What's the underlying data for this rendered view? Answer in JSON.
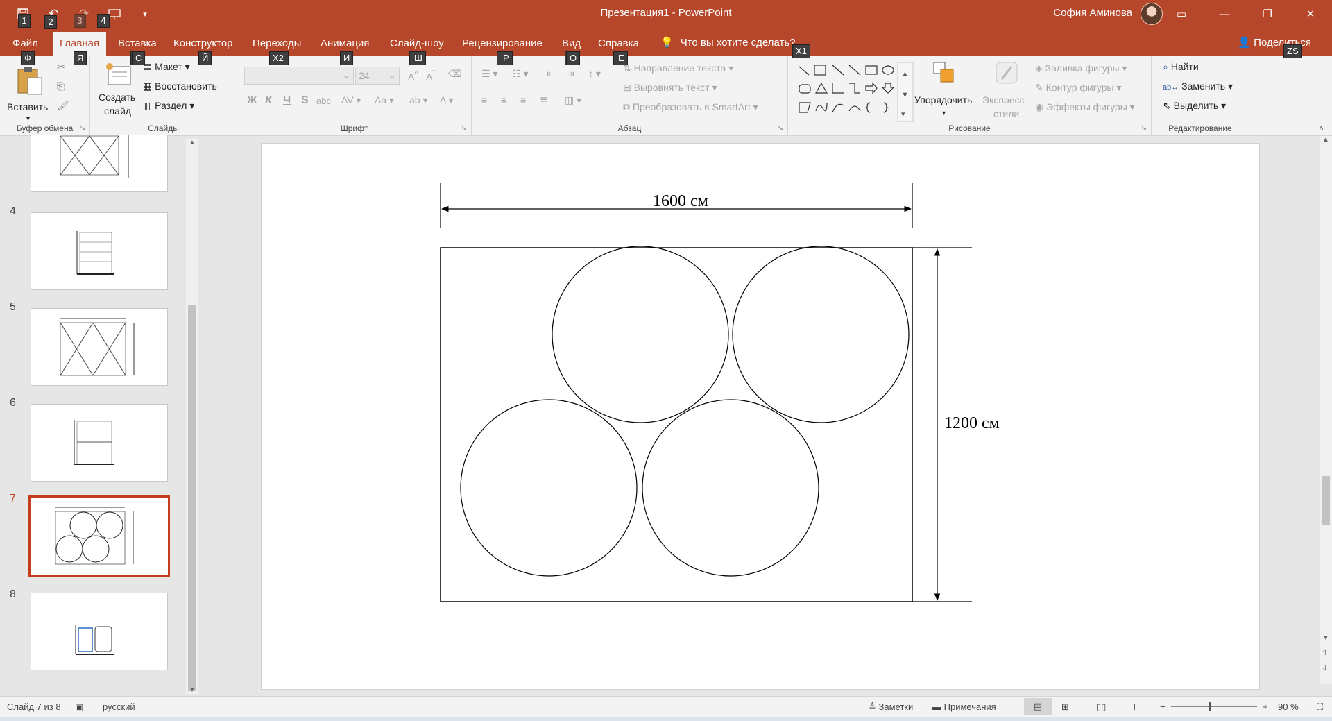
{
  "window": {
    "title": "Презентация1  -  PowerPoint",
    "user": "София Аминова"
  },
  "qat_keytips": [
    "1",
    "2",
    "3",
    "4"
  ],
  "tabs": [
    {
      "label": "Файл",
      "keytip": "Ф"
    },
    {
      "label": "Главная",
      "keytip": "Я"
    },
    {
      "label": "Вставка",
      "keytip": "С"
    },
    {
      "label": "Конструктор",
      "keytip": "Й"
    },
    {
      "label": "Переходы",
      "keytip": "Х2"
    },
    {
      "label": "Анимация",
      "keytip": "И"
    },
    {
      "label": "Слайд-шоу",
      "keytip": "Ш"
    },
    {
      "label": "Рецензирование",
      "keytip": "Р"
    },
    {
      "label": "Вид",
      "keytip": "О"
    },
    {
      "label": "Справка",
      "keytip": "Е"
    }
  ],
  "tell_me": "Что вы хотите сделать?",
  "tell_me_keytip": "Х1",
  "share": "Поделиться",
  "share_keytip": "ZS",
  "ribbon": {
    "clipboard": {
      "paste": "Вставить",
      "label": "Буфер обмена"
    },
    "slides": {
      "new_slide_1": "Создать",
      "new_slide_2": "слайд",
      "layout": "Макет",
      "reset": "Восстановить",
      "section": "Раздел",
      "label": "Слайды"
    },
    "font": {
      "size": "24",
      "bold": "Ж",
      "italic": "К",
      "underline": "Ч",
      "shadow": "S",
      "strike": "abc",
      "spacing": "AV",
      "case": "Aa",
      "label": "Шрифт"
    },
    "paragraph": {
      "text_direction": "Направление текста",
      "align_text": "Выровнять текст",
      "smartart": "Преобразовать в SmartArt",
      "label": "Абзац"
    },
    "drawing": {
      "arrange": "Упорядочить",
      "quick_styles_1": "Экспресс-",
      "quick_styles_2": "стили",
      "fill": "Заливка фигуры",
      "outline": "Контур фигуры",
      "effects": "Эффекты фигуры",
      "label": "Рисование"
    },
    "editing": {
      "find": "Найти",
      "replace": "Заменить",
      "select": "Выделить",
      "label": "Редактирование"
    }
  },
  "thumbnails": [
    {
      "number": "4"
    },
    {
      "number": "5"
    },
    {
      "number": "6"
    },
    {
      "number": "7"
    },
    {
      "number": "8"
    }
  ],
  "slide": {
    "width_label": "1600 см",
    "height_label": "1200 см"
  },
  "status": {
    "slide_info": "Слайд 7 из 8",
    "language": "русский",
    "notes": "Заметки",
    "comments": "Примечания",
    "zoom": "90 %"
  },
  "colors": {
    "accent": "#b7472a",
    "active_thumb": "#c43e1c"
  }
}
